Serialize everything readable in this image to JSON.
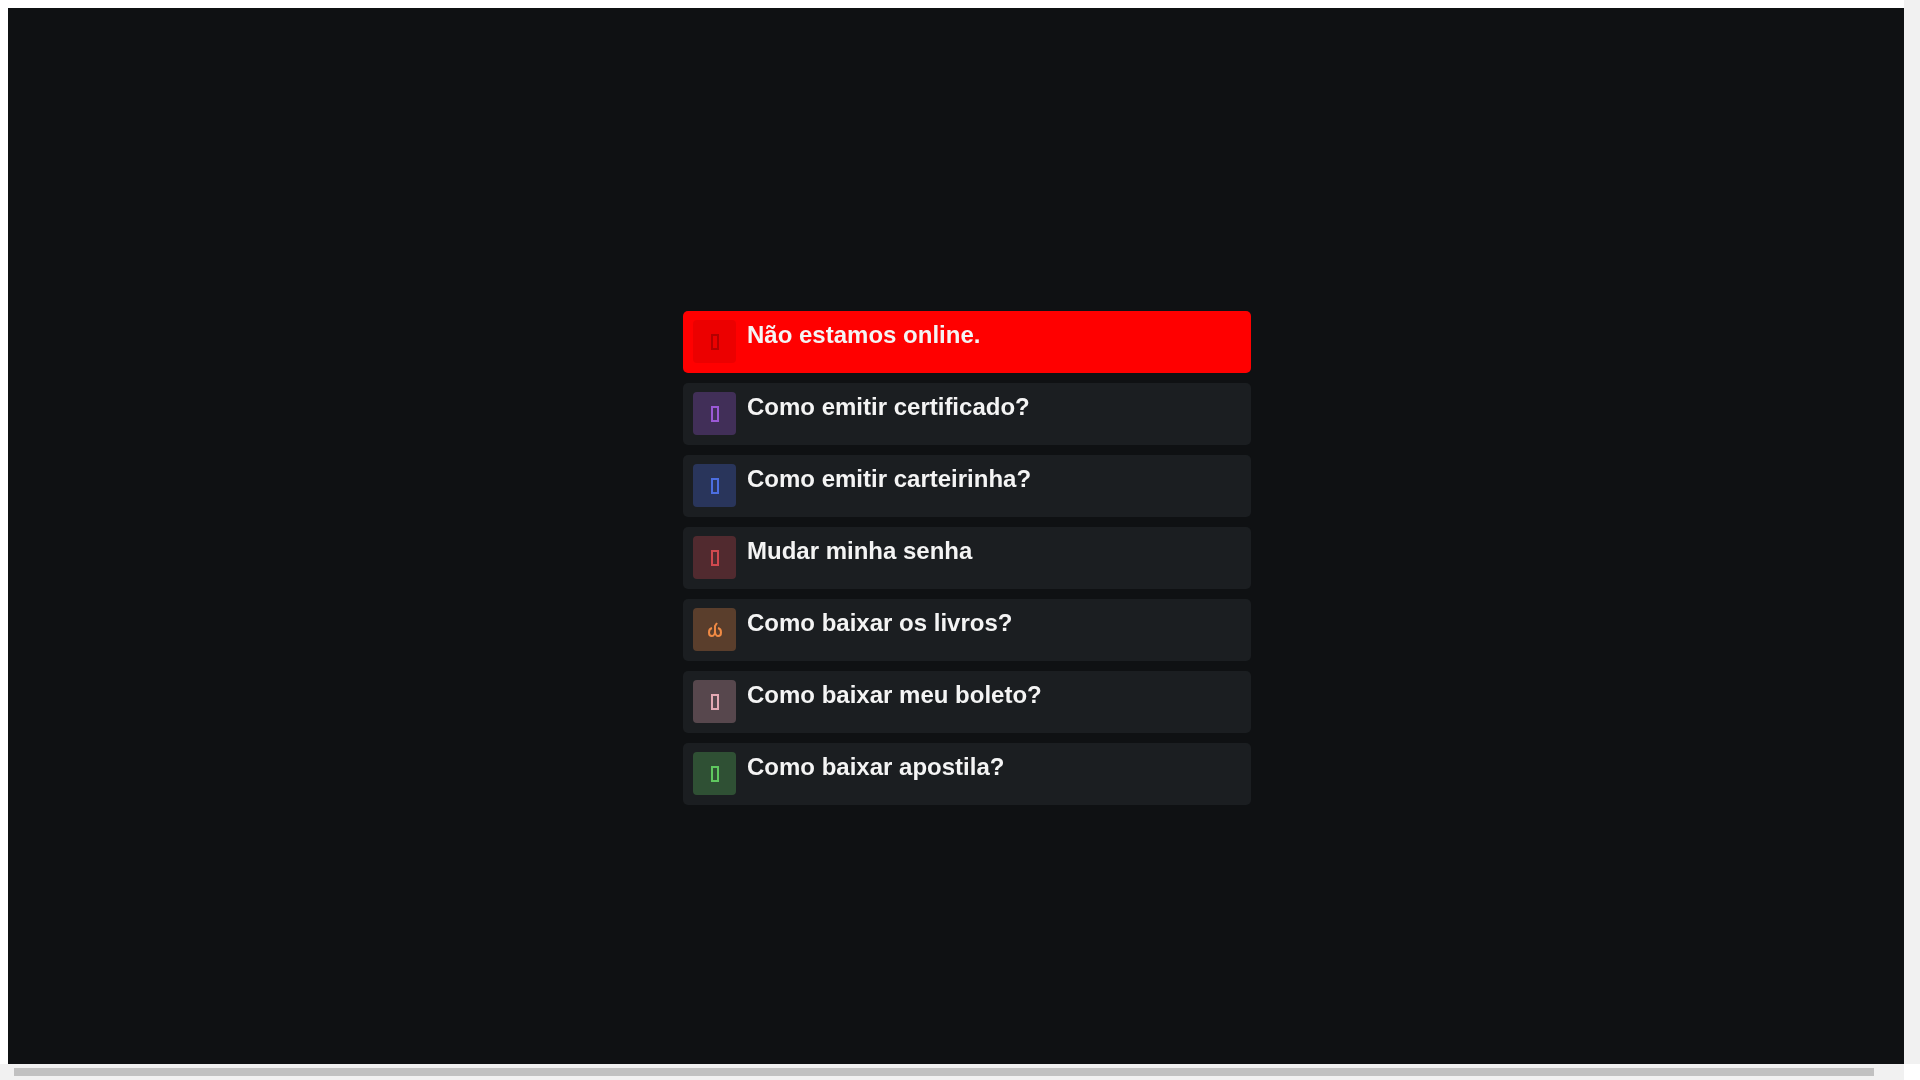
{
  "items": [
    {
      "kind": "alert",
      "label": "Não estamos online.",
      "color": "#b30000"
    },
    {
      "kind": "question",
      "label": "Como emitir certificado?",
      "color": "#9b59d6"
    },
    {
      "kind": "question",
      "label": "Como emitir carteirinha?",
      "color": "#4c6ee0"
    },
    {
      "kind": "question",
      "label": "Mudar minha senha",
      "color": "#d0494f"
    },
    {
      "kind": "question",
      "label": "Como baixar os livros?",
      "color": "#f08a44"
    },
    {
      "kind": "question",
      "label": "Como baixar meu boleto?",
      "color": "#e3a9b3"
    },
    {
      "kind": "question",
      "label": "Como baixar apostila?",
      "color": "#5fc85f"
    }
  ]
}
